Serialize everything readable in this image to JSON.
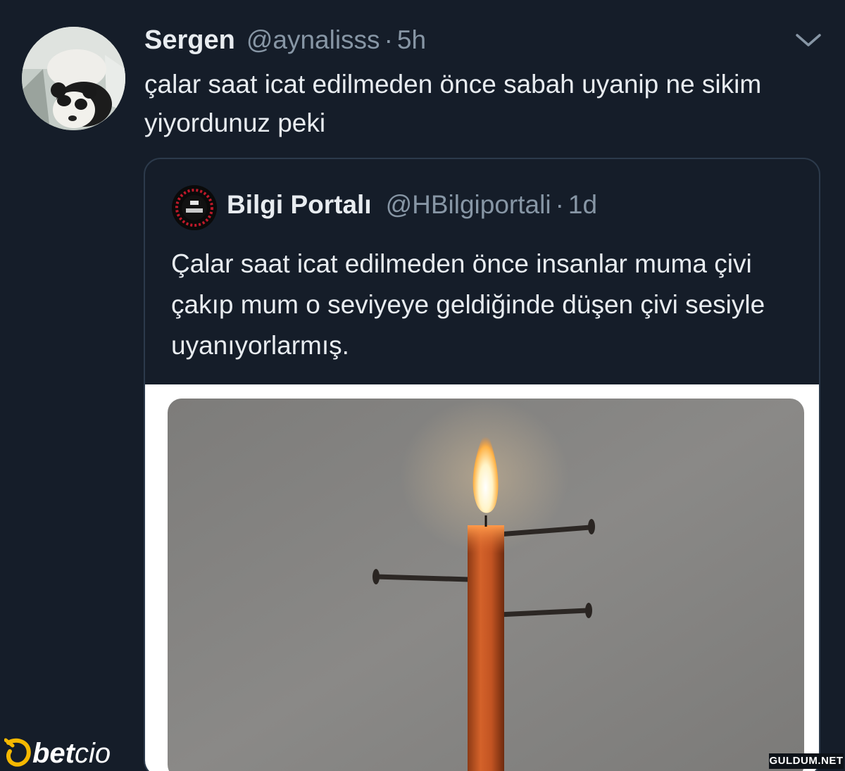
{
  "tweet": {
    "display_name": "Sergen",
    "handle": "@aynalisss",
    "separator": "·",
    "time": "5h",
    "text": "çalar saat icat edilmeden önce sabah uyanip ne sikim yiyordunuz peki",
    "avatar_icon": "panda-avatar-icon",
    "menu_icon": "chevron-down-icon"
  },
  "quoted_tweet": {
    "display_name": "Bilgi Portalı",
    "handle": "@HBilgiportali",
    "separator": "·",
    "time": "1d",
    "text": "Çalar saat icat edilmeden önce insanlar muma çivi çakıp mum o seviyeye geldiğinde düşen çivi sesiyle uyanıyorlarmış.",
    "avatar_icon": "bilgi-portali-logo-icon",
    "image": "candle-with-nails-photo"
  },
  "watermarks": {
    "left_bet": "bet",
    "left_cio": "cio",
    "right": "GULDUM.NET"
  },
  "colors": {
    "background": "#151d29",
    "primary_text": "#e8ecf0",
    "secondary_text": "#8796a5",
    "border": "#2c3a4b",
    "accent_watermark": "#f5b800"
  }
}
